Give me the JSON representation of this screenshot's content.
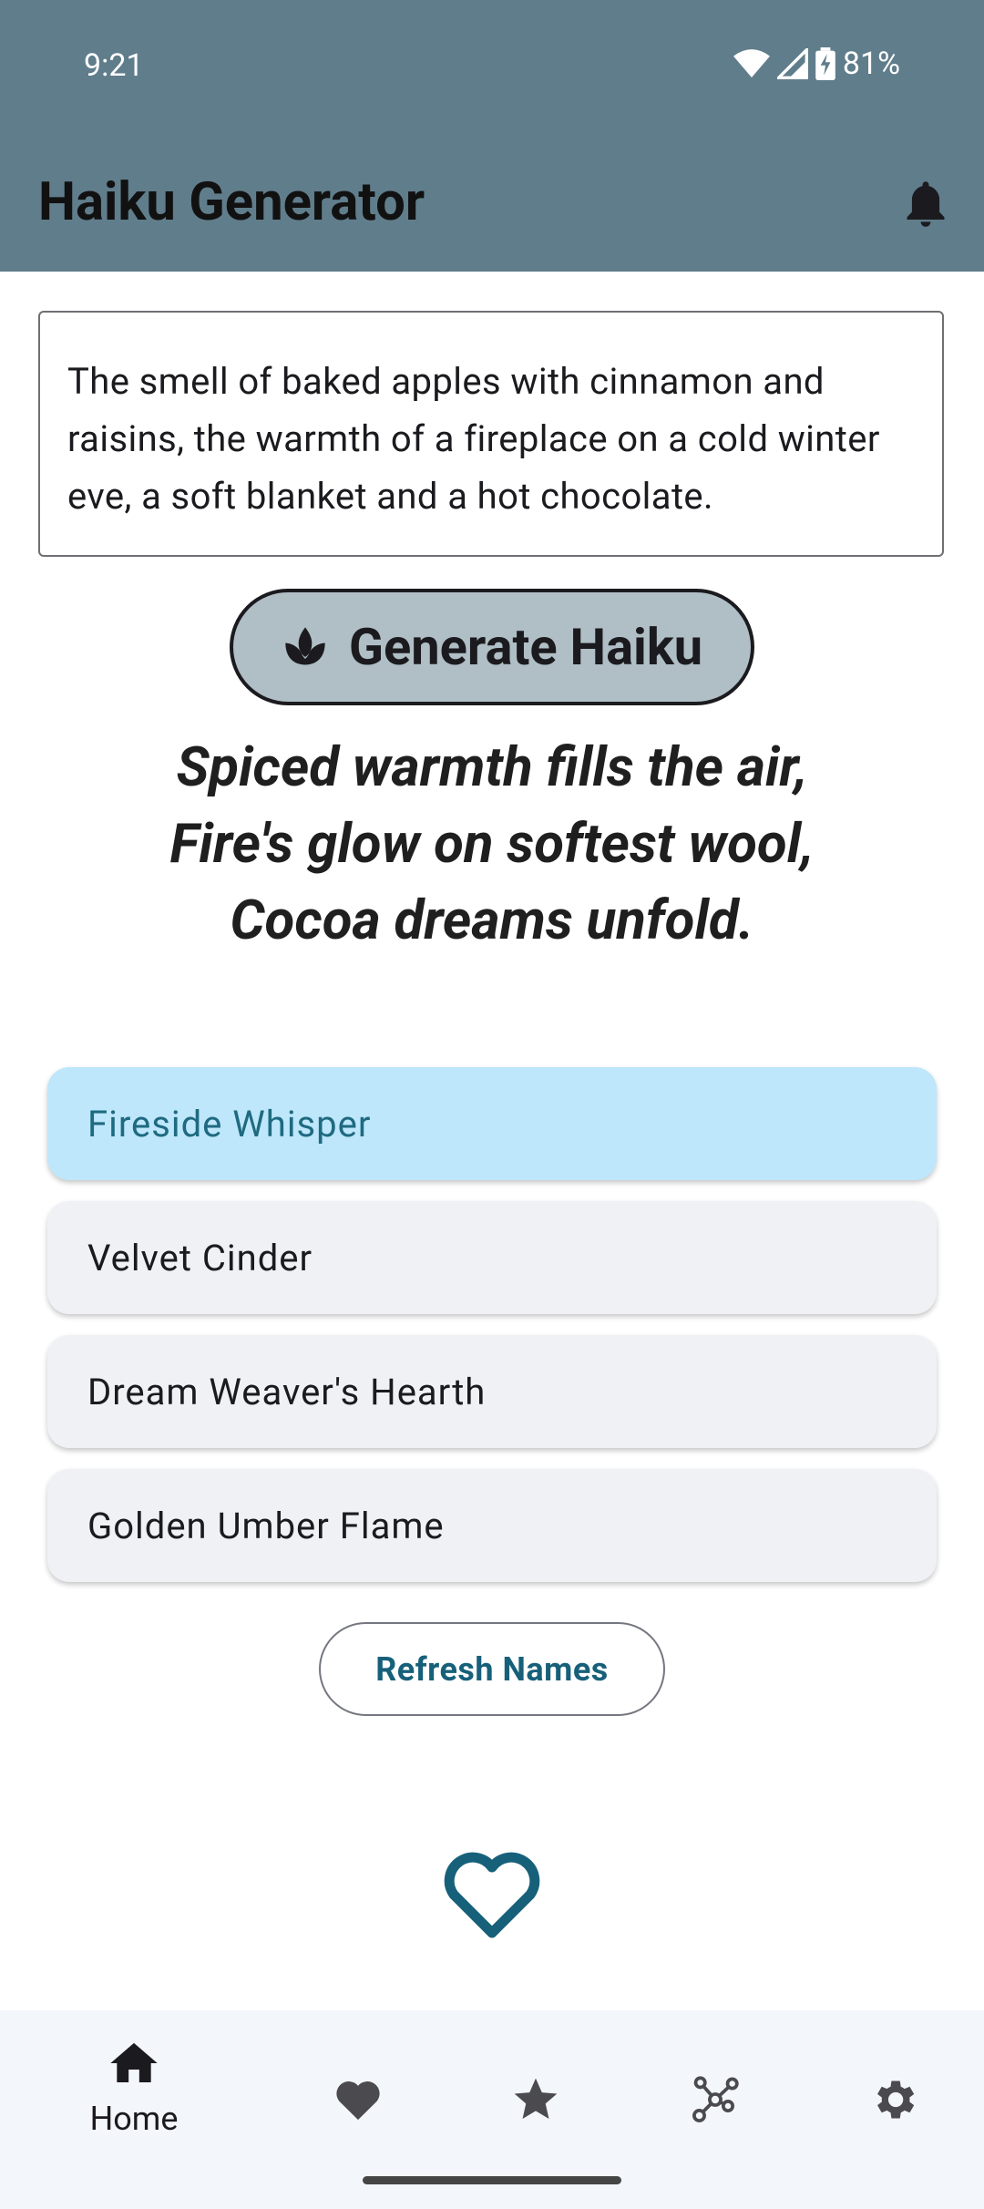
{
  "status": {
    "time": "9:21",
    "battery": "81%"
  },
  "appbar": {
    "title": "Haiku Generator"
  },
  "prompt": {
    "text": "The smell of baked apples with cinnamon and raisins, the warmth of a fireplace on a cold winter eve, a soft blanket and a hot chocolate."
  },
  "generate_button": {
    "label": "Generate Haiku"
  },
  "haiku": {
    "line1": "Spiced warmth fills the air,",
    "line2": "Fire's glow on softest wool,",
    "line3": "Cocoa dreams unfold."
  },
  "names": [
    {
      "label": "Fireside Whisper",
      "selected": true
    },
    {
      "label": "Velvet Cinder",
      "selected": false
    },
    {
      "label": "Dream Weaver's Hearth",
      "selected": false
    },
    {
      "label": "Golden Umber Flame",
      "selected": false
    }
  ],
  "refresh_button": {
    "label": "Refresh Names"
  },
  "bottom_nav": {
    "home_label": "Home",
    "items": [
      "home-icon",
      "heart-icon",
      "star-icon",
      "graph-icon",
      "settings-icon"
    ]
  },
  "colors": {
    "appbar": "#607d8b",
    "selected_card": "#bee7fb",
    "accent": "#17607a",
    "generate_button": "#b0bec5"
  }
}
